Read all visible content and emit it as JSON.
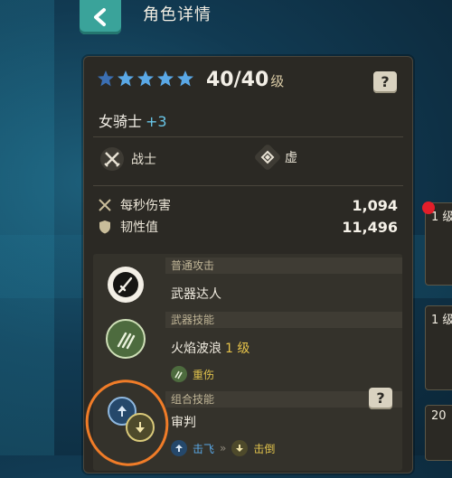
{
  "header": {
    "title": "角色详情"
  },
  "hero": {
    "stars": 5,
    "level": "40",
    "sep": "/",
    "max_level": "40",
    "level_unit": "级",
    "name": "女骑士",
    "bonus": "+3",
    "class_label": "战士",
    "element_label": "虚"
  },
  "stats": [
    {
      "label": "每秒伤害",
      "value": "1,094"
    },
    {
      "label": "韧性值",
      "value": "11,496"
    }
  ],
  "skills": {
    "normal": {
      "header": "普通攻击",
      "name": "武器达人"
    },
    "weapon": {
      "header": "武器技能",
      "name": "火焰波浪",
      "level": "1 级",
      "sub": "重伤"
    },
    "combo": {
      "header": "组合技能",
      "name": "审判",
      "sub1": "击飞",
      "arrows": "»",
      "sub2": "击倒"
    }
  },
  "help_label": "?",
  "side": {
    "card1": "1 级",
    "card2": "1 级",
    "card3": "20"
  },
  "colors": {
    "accent_teal": "#3aa39a",
    "gold": "#e6c34a",
    "plus_blue": "#69c6e8",
    "star_blue": "#5aa8e6"
  }
}
